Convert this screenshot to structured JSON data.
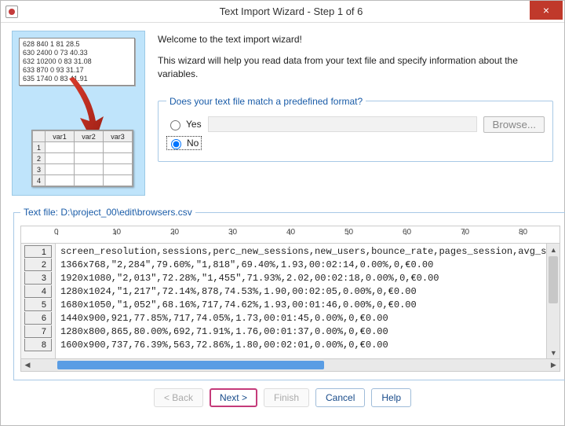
{
  "title": "Text Import Wizard - Step 1 of 6",
  "close_label": "×",
  "illustration": {
    "text_lines": [
      "628 840 1 81 28.5",
      "630 2400 0 73 40.33",
      "632 10200 0 83 31.08",
      "633 870 0 93 31.17",
      "635 1740 0 83 41.91"
    ],
    "grid_headers": [
      "var1",
      "var2",
      "var3"
    ],
    "grid_rows": [
      "1",
      "2",
      "3",
      "4"
    ]
  },
  "welcome": {
    "heading": "Welcome to the text import wizard!",
    "body": "This wizard will help you read data from your text file and specify information about the variables."
  },
  "predef": {
    "legend": "Does your text file match a predefined format?",
    "yes_label": "Yes",
    "no_label": "No",
    "browse_label": "Browse...",
    "selected": "no"
  },
  "file": {
    "legend_prefix": "Text file:  ",
    "path": "D:\\project_00\\edit\\browsers.csv",
    "ruler_ticks": [
      "0",
      "10",
      "20",
      "30",
      "40",
      "50",
      "60",
      "70",
      "80"
    ],
    "row_numbers": [
      "1",
      "2",
      "3",
      "4",
      "5",
      "6",
      "7",
      "8"
    ],
    "lines": [
      "screen_resolution,sessions,perc_new_sessions,new_users,bounce_rate,pages_session,avg_s",
      "1366x768,\"2,284\",79.60%,\"1,818\",69.40%,1.93,00:02:14,0.00%,0,€0.00",
      "1920x1080,\"2,013\",72.28%,\"1,455\",71.93%,2.02,00:02:18,0.00%,0,€0.00",
      "1280x1024,\"1,217\",72.14%,878,74.53%,1.90,00:02:05,0.00%,0,€0.00",
      "1680x1050,\"1,052\",68.16%,717,74.62%,1.93,00:01:46,0.00%,0,€0.00",
      "1440x900,921,77.85%,717,74.05%,1.73,00:01:45,0.00%,0,€0.00",
      "1280x800,865,80.00%,692,71.91%,1.76,00:01:37,0.00%,0,€0.00",
      "1600x900,737,76.39%,563,72.86%,1.80,00:02:01,0.00%,0,€0.00"
    ]
  },
  "buttons": {
    "back": "< Back",
    "next": "Next >",
    "finish": "Finish",
    "cancel": "Cancel",
    "help": "Help"
  }
}
